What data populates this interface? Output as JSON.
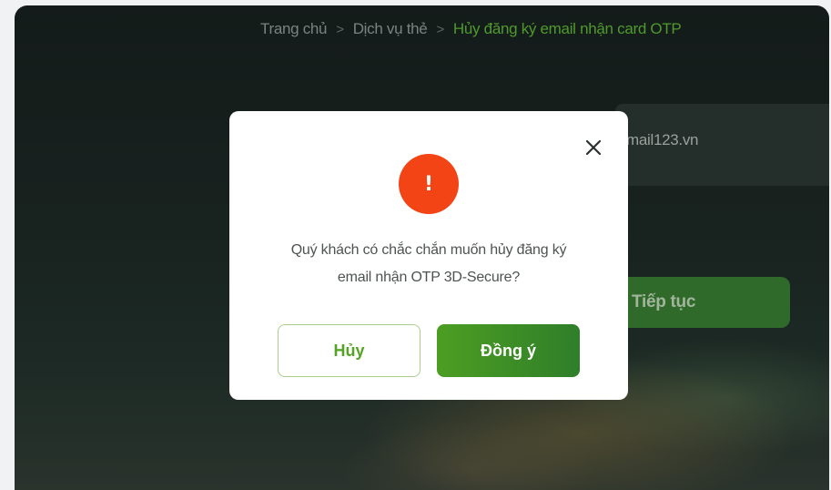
{
  "breadcrumb": {
    "items": [
      "Trang chủ",
      "Dịch vụ thẻ"
    ],
    "current": "Hủy đăng ký email nhận card OTP",
    "separator": ">"
  },
  "background": {
    "email_value": "mail123.vn",
    "continue_label": "Tiếp tục"
  },
  "dialog": {
    "icon": "exclamation-icon",
    "icon_glyph": "!",
    "message_line1": "Quý khách có chắc chắn muốn hủy đăng ký",
    "message_line2": "email nhận OTP 3D-Secure?",
    "cancel_label": "Hủy",
    "confirm_label": "Đồng ý",
    "close_icon": "close-icon"
  },
  "colors": {
    "accent_green": "#4f9a2c",
    "alert_orange": "#f24414",
    "confirm_button": "#3e8f26"
  }
}
